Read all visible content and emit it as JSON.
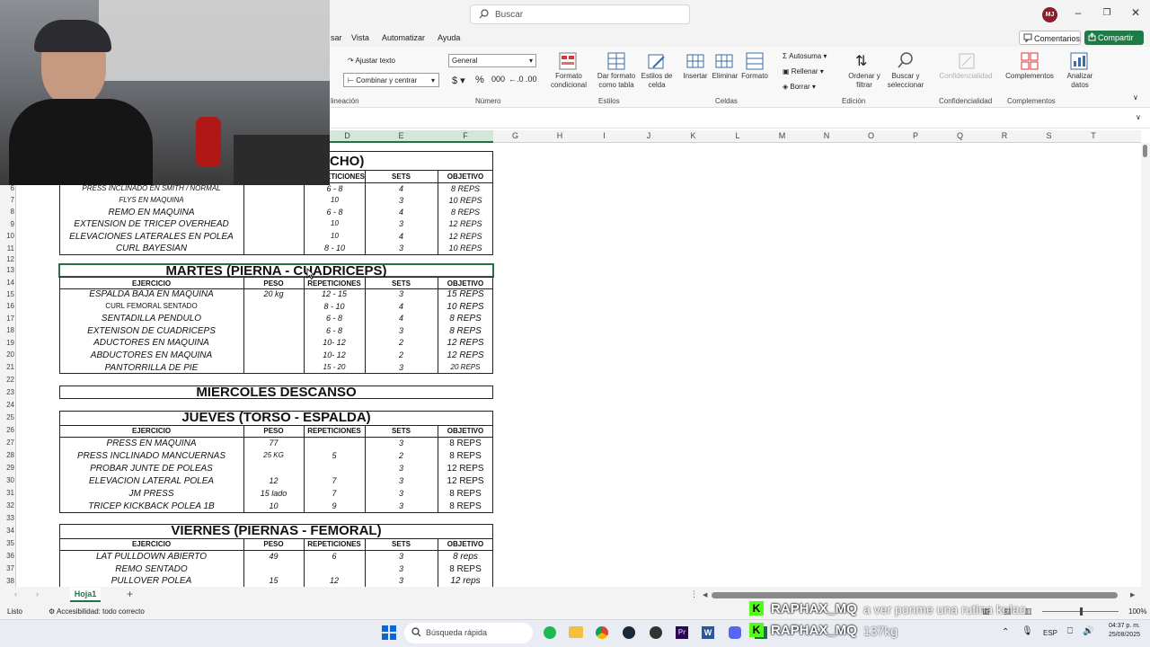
{
  "titlebar": {
    "search_placeholder": "Buscar",
    "avatar_initials": "MJ"
  },
  "menu_tabs": [
    "sar",
    "Vista",
    "Automatizar",
    "Ayuda"
  ],
  "actions": {
    "comments": "Comentarios",
    "share": "Compartir"
  },
  "ribbon": {
    "wrap_text": "Ajustar texto",
    "merge_center": "Combinar y centrar",
    "alignment_group": "lineación",
    "number_format": "General",
    "number_group": "Número",
    "cond_format": "Formato condicional",
    "format_table": "Dar formato como tabla",
    "cell_styles": "Estilos de celda",
    "styles_group": "Estilos",
    "insert": "Insertar",
    "delete": "Eliminar",
    "format": "Formato",
    "cells_group": "Celdas",
    "autosum": "Autosuma",
    "fill": "Rellenar",
    "clear": "Borrar",
    "sort_filter": "Ordenar y filtrar",
    "find_select": "Buscar y seleccionar",
    "editing_group": "Edición",
    "sensitivity": "Confidencialidad",
    "sensitivity_group": "Confidencialidad",
    "addins": "Complementos",
    "addins_group": "Complementos",
    "analyze": "Analizar datos"
  },
  "columns": [
    "D",
    "E",
    "F",
    "G",
    "H",
    "I",
    "J",
    "K",
    "L",
    "M",
    "N",
    "O",
    "P",
    "Q",
    "R",
    "S",
    "T"
  ],
  "rows": [
    "6",
    "7",
    "8",
    "9",
    "10",
    "11",
    "12",
    "13",
    "14",
    "15",
    "16",
    "17",
    "18",
    "19",
    "20",
    "21",
    "22",
    "23",
    "24",
    "25",
    "26",
    "27",
    "28",
    "29",
    "30",
    "31",
    "32",
    "33",
    "34",
    "35",
    "36",
    "37",
    "38"
  ],
  "sheet": {
    "block1_title": "CHO)",
    "block1_headers": {
      "reps": "ETICIONES",
      "sets": "SETS",
      "goal": "OBJETIVO"
    },
    "block1_rows": [
      [
        "PRESS INCLINADO EN SMITH / NORMAL",
        "",
        "6 - 8",
        "4",
        "8 REPS"
      ],
      [
        "FLYS EN MAQUINA",
        "",
        "10",
        "3",
        "10 REPS"
      ],
      [
        "REMO EN MAQUINA",
        "",
        "6 - 8",
        "4",
        "8 REPS"
      ],
      [
        "EXTENSION DE TRICEP OVERHEAD",
        "",
        "10",
        "3",
        "12 REPS"
      ],
      [
        "ELEVACIONES LATERALES EN POLEA",
        "",
        "10",
        "4",
        "12 REPS"
      ],
      [
        "CURL BAYESIAN",
        "",
        "8 - 10",
        "3",
        "10 REPS"
      ]
    ],
    "headers": {
      "exercise": "EJERCICIO",
      "weight": "PESO",
      "reps": "REPETICIONES",
      "sets": "SETS",
      "goal": "OBJETIVO"
    },
    "block2_title": "MARTES (PIERNA - CUADRICEPS)",
    "block2_rows": [
      [
        "ESPALDA BAJA EN MAQUINA",
        "20 kg",
        "12 - 15",
        "3",
        "15 REPS"
      ],
      [
        "CURL FEMORAL SENTADO",
        "",
        "8 - 10",
        "4",
        "10 REPS"
      ],
      [
        "SENTADILLA PENDULO",
        "",
        "6 - 8",
        "4",
        "8 REPS"
      ],
      [
        "EXTENISON DE CUADRICEPS",
        "",
        "6 - 8",
        "3",
        "8 REPS"
      ],
      [
        "ADUCTORES EN MAQUINA",
        "",
        "10- 12",
        "2",
        "12 REPS"
      ],
      [
        "ABDUCTORES EN MAQUINA",
        "",
        "10- 12",
        "2",
        "12 REPS"
      ],
      [
        "PANTORRILLA DE PIE",
        "",
        "15 - 20",
        "3",
        "20 REPS"
      ]
    ],
    "block3_title": "MIERCOLES DESCANSO",
    "block4_title": "JUEVES (TORSO - ESPALDA)",
    "block4_rows": [
      [
        "PRESS EN MAQUINA",
        "77",
        "",
        "3",
        "8 REPS"
      ],
      [
        "PRESS INCLINADO MANCUERNAS",
        "25 KG",
        "5",
        "2",
        "8 REPS"
      ],
      [
        "PROBAR JUNTE DE POLEAS",
        "",
        "",
        "3",
        "12 REPS"
      ],
      [
        "ELEVACION LATERAL POLEA",
        "12",
        "7",
        "3",
        "12 REPS"
      ],
      [
        "JM PRESS",
        "15 lado",
        "7",
        "3",
        "8 REPS"
      ],
      [
        "TRICEP KICKBACK POLEA 1B",
        "10",
        "9",
        "3",
        "8 REPS"
      ]
    ],
    "block5_title": "VIERNES (PIERNAS - FEMORAL)",
    "block5_rows": [
      [
        "LAT PULLDOWN ABIERTO",
        "49",
        "6",
        "3",
        "8 reps"
      ],
      [
        "REMO SENTADO",
        "",
        "",
        "3",
        "8 REPS"
      ],
      [
        "PULLOVER POLEA",
        "15",
        "12",
        "3",
        "12 reps"
      ]
    ]
  },
  "sheet_tab": "Hoja1",
  "status": {
    "ready": "Listo",
    "accessibility": "Accesibilidad: todo correcto",
    "zoom": "100%"
  },
  "taskbar": {
    "search": "Búsqueda rápida",
    "lang": "ESP",
    "time": "04:37 p. m.",
    "date": "25/08/2025"
  },
  "overlay": {
    "user1": "RAPHAX_MQ",
    "msg1": "a ver ponme una rutina kulao",
    "user2": "RAPHAX_MQ",
    "msg2": "137kg"
  }
}
